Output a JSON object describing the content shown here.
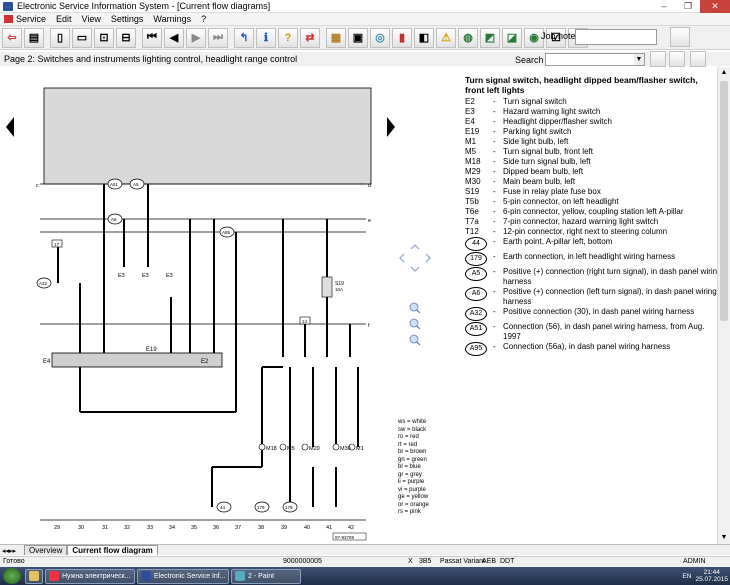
{
  "window": {
    "title": "Electronic Service Information System - [Current flow diagrams]"
  },
  "menu": [
    "Service",
    "Edit",
    "View",
    "Settings",
    "Warnings",
    "?"
  ],
  "toolbar": {
    "job_note_label": "Job note:",
    "icons": [
      "exit-icon",
      "print-icon",
      "new-doc-icon",
      "open-doc-icon",
      "car-icon",
      "car2-icon",
      "first-page-icon",
      "prev-page-icon",
      "next-page-icon",
      "last-page-icon",
      "back-icon",
      "info-icon",
      "help-icon",
      "swap-icon",
      "repair-icon",
      "wiring-icon",
      "assembly-icon",
      "book-icon",
      "flow-icon",
      "warning-icon",
      "globe-icon",
      "parts-icon",
      "repair2-icon",
      "engine-icon",
      "checklist-icon",
      "bulb-icon"
    ]
  },
  "page_title": "Page 2: Switches and instruments lighting control, headlight range control",
  "search": {
    "label": "Search term:",
    "value": ""
  },
  "legend": {
    "title": "Turn signal switch, headlight dipped beam/flasher switch, front left lights",
    "items": [
      {
        "code": "E2",
        "desc": "Turn signal switch"
      },
      {
        "code": "E3",
        "desc": "Hazard warning light switch"
      },
      {
        "code": "E4",
        "desc": "Headlight dipper/flasher switch"
      },
      {
        "code": "E19",
        "desc": "Parking light switch"
      },
      {
        "code": "M1",
        "desc": "Side light bulb, left"
      },
      {
        "code": "M5",
        "desc": "Turn signal bulb, front left"
      },
      {
        "code": "M18",
        "desc": "Side turn signal bulb, left"
      },
      {
        "code": "M29",
        "desc": "Dipped beam bulb, left"
      },
      {
        "code": "M30",
        "desc": "Main beam bulb, left"
      },
      {
        "code": "S19",
        "desc": "Fuse in relay plate fuse box"
      },
      {
        "code": "T5b",
        "desc": "5-pin connector, on left headlight"
      },
      {
        "code": "T6e",
        "desc": "6-pin connector, yellow, coupling station left A-pillar"
      },
      {
        "code": "T7a",
        "desc": "7-pin connector, hazard warning light switch"
      },
      {
        "code": "T12",
        "desc": "12-pin connector, right next to steering column"
      }
    ],
    "circle_items": [
      {
        "code": "44",
        "desc": "Earth point, A-pillar left, bottom"
      },
      {
        "code": "179",
        "desc": "Earth connection, in left headlight wiring harness"
      },
      {
        "code": "A5",
        "desc": "Positive (+) connection (right turn signal), in dash panel wiring harness"
      },
      {
        "code": "A6",
        "desc": "Positive (+) connection (left turn signal), in dash panel wiring harness"
      },
      {
        "code": "A32",
        "desc": "Positive connection (30), in dash panel wiring harness"
      },
      {
        "code": "A51",
        "desc": "Connection (56), in dash panel wiring harness, from Aug. 1997"
      },
      {
        "code": "A95",
        "desc": "Connection (56a), in dash panel wiring harness"
      }
    ]
  },
  "colour_key": [
    "ws = white",
    "sw = black",
    "ro = red",
    "rt = red",
    "br = brown",
    "gn = green",
    "bl = blue",
    "gr = grey",
    "li = purple",
    "vi = purple",
    "ge = yellow",
    "or = orange",
    "rs = pink"
  ],
  "diagram": {
    "rails": [
      "c",
      "d",
      "e",
      "f"
    ],
    "connections": [
      "A51",
      "A5",
      "A6",
      "A32",
      "A95",
      "17",
      "14"
    ],
    "components": [
      "E4",
      "E19",
      "E2",
      "E3",
      "S19",
      "M18",
      "M5",
      "M29",
      "M30",
      "M1"
    ],
    "bottom_numbers": [
      "29",
      "30",
      "31",
      "32",
      "33",
      "34",
      "35",
      "36",
      "37",
      "38",
      "39",
      "40",
      "41",
      "42"
    ],
    "earth_points": [
      "44",
      "179",
      "179"
    ],
    "fuse_labels": [
      "S19",
      "10A"
    ],
    "ref": "97-93789"
  },
  "tabs": [
    "Overview",
    "Current flow diagram"
  ],
  "status": {
    "ready": "Готово",
    "code": "9000000005",
    "x": "X",
    "n385": "3B5",
    "model": "Passat Variant",
    "aeb": "AEB",
    "ddt": "DDT",
    "user": "ADMIN"
  },
  "taskbar": {
    "items": [
      "Нужна электрическ...",
      "Electronic Service Inf...",
      "2 - Paint"
    ],
    "lang": "EN",
    "time": "21:44",
    "date": "25.07.2015"
  }
}
